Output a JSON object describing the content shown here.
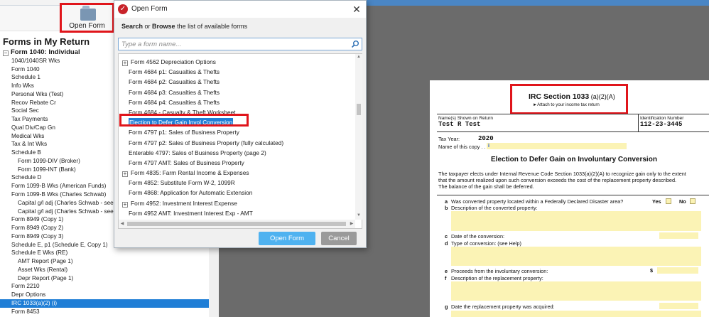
{
  "toolbar": {
    "open_form_label": "Open Form"
  },
  "left_panel": {
    "title": "Forms in My Return",
    "tree": [
      {
        "label": "Form 1040:  Individual",
        "level": 0,
        "expander": "−"
      },
      {
        "label": "1040/1040SR Wks",
        "level": 1
      },
      {
        "label": "Form 1040",
        "level": 1
      },
      {
        "label": "Schedule 1",
        "level": 1
      },
      {
        "label": "Info Wks",
        "level": 1
      },
      {
        "label": "Personal Wks (Test)",
        "level": 1
      },
      {
        "label": "Recov Rebate Cr",
        "level": 1
      },
      {
        "label": "Social Sec",
        "level": 1
      },
      {
        "label": "Tax Payments",
        "level": 1
      },
      {
        "label": "Qual Div/Cap Gn",
        "level": 1
      },
      {
        "label": "Medical Wks",
        "level": 1
      },
      {
        "label": "Tax & Int Wks",
        "level": 1
      },
      {
        "label": "Schedule B",
        "level": 1
      },
      {
        "label": "Form 1099-DIV (Broker)",
        "level": 2
      },
      {
        "label": "Form 1099-INT (Bank)",
        "level": 2
      },
      {
        "label": "Schedule D",
        "level": 1
      },
      {
        "label": "Form 1099-B Wks (American Funds)",
        "level": 1
      },
      {
        "label": "Form 1099-B Wks (Charles Schwab)",
        "level": 1
      },
      {
        "label": "Capital g/l adj (Charles Schwab - see attac",
        "level": 2
      },
      {
        "label": "Capital g/l adj (Charles Schwab - see attac",
        "level": 2
      },
      {
        "label": "Form 8949 (Copy 1)",
        "level": 1
      },
      {
        "label": "Form 8949 (Copy 2)",
        "level": 1
      },
      {
        "label": "Form 8949 (Copy 3)",
        "level": 1
      },
      {
        "label": "Schedule E, p1 (Schedule E, Copy 1)",
        "level": 1
      },
      {
        "label": "Schedule E Wks (RE)",
        "level": 1
      },
      {
        "label": "AMT Report (Page 1)",
        "level": 2
      },
      {
        "label": "Asset Wks (Rental)",
        "level": 2
      },
      {
        "label": "Depr Report (Page 1)",
        "level": 2
      },
      {
        "label": "Form 2210",
        "level": 1
      },
      {
        "label": "Depr Options",
        "level": 1
      },
      {
        "label": "IRC 1033(a)(2) (i)",
        "level": 1,
        "selected": true
      },
      {
        "label": "Form 8453",
        "level": 1
      }
    ]
  },
  "dialog": {
    "title": "Open Form",
    "close_glyph": "✕",
    "instruction_search": "Search",
    "instruction_or": " or ",
    "instruction_browse": "Browse",
    "instruction_rest": " the list of available forms",
    "search_placeholder": "Type a form name...",
    "list": [
      {
        "label": "Form 4562 Depreciation Options",
        "expander": "+"
      },
      {
        "label": "Form 4684 p1: Casualties & Thefts"
      },
      {
        "label": "Form 4684 p2: Casualties & Thefts"
      },
      {
        "label": "Form 4684 p3: Casualties & Thefts"
      },
      {
        "label": "Form 4684 p4: Casualties & Thefts"
      },
      {
        "label": "Form 4684 - Casualty & Theft Worksheet"
      },
      {
        "label": "Election to Defer Gain Invol Conversion",
        "selected": true
      },
      {
        "label": "Form 4797 p1: Sales of Business Property"
      },
      {
        "label": "Form 4797 p2: Sales of Business Property (fully calculated)"
      },
      {
        "label": "Enterable 4797: Sales of Business Property (page 2)"
      },
      {
        "label": "Form 4797 AMT: Sales of Business Property"
      },
      {
        "label": "Form 4835: Farm Rental Income & Expenses",
        "expander": "+"
      },
      {
        "label": "Form 4852: Substitute Form W-2, 1099R"
      },
      {
        "label": "Form 4868: Application for Automatic Extension"
      },
      {
        "label": "Form 4952: Investment Interest Expense",
        "expander": "+"
      },
      {
        "label": "Form 4952 AMT: Investment Interest Exp - AMT"
      }
    ],
    "open_button": "Open Form",
    "cancel_button": "Cancel"
  },
  "document": {
    "title_main": "IRC Section  1033",
    "title_suffix": " (a)(2)(A)",
    "attach": "►Attach to your income tax return",
    "name_label": "Name(s)  Shown on Return",
    "name_value": "Test R Test",
    "id_label": "Identification Number",
    "id_value": "112-23-3445",
    "tax_year_label": "Tax Year:",
    "tax_year_value": "2020",
    "copy_label": "Name of this copy . . . . . . . . . .",
    "info_mark": "i",
    "heading": "Election to Defer Gain on Involuntary Conversion",
    "paragraph": [
      "The taxpayer elects under Internal Revenue Code Section 1033(a)(2)(A) to recognize gain only to the extent",
      "that the amount realized upon such conversion exceeds the cost of the replacement property described.",
      "The balance of the gain shall be deferred."
    ],
    "lines": {
      "a": "Was converted property located within a Federally Declared Disaster area?",
      "b": "Description of the converted property:",
      "c": "Date of the conversion:",
      "d": "Type of conversion:  (see Help)",
      "e": "Proceeds from the involuntary conversion:",
      "f": "Description of the replacement property:",
      "g": "Date the replacement property was acquired:"
    },
    "yes_label": "Yes",
    "no_label": "No",
    "dollar": "$"
  }
}
